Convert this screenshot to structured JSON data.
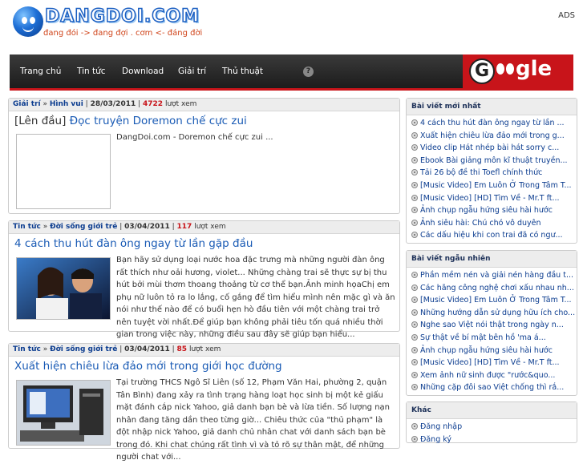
{
  "header": {
    "logo_text": "DANGDOI.COM",
    "tagline": "đang đói -> đang đợi . cơm <- đáng đời",
    "ads": "ADS"
  },
  "nav": {
    "items": [
      "Trang chủ",
      "Tin tức",
      "Download",
      "Giải trí",
      "Thủ thuật"
    ],
    "help": "?",
    "google_badge": "G",
    "google_word": "gle"
  },
  "posts": [
    {
      "cat1": "Giải trí",
      "sep": "»",
      "cat2": "Hình vui",
      "date": "28/03/2011",
      "views": "4722",
      "views_label": "lượt xem",
      "title_prefix": "[Lên đầu]",
      "title": "Đọc truyện Doremon chế cực zui",
      "excerpt": "DangDoi.com - Doremon chế cực zui ..."
    },
    {
      "cat1": "Tin tức",
      "sep": "»",
      "cat2": "Đời sống giới trẻ",
      "date": "03/04/2011",
      "views": "117",
      "views_label": "lượt xem",
      "title": "4 cách thu hút đàn ông ngay từ lần gặp đầu",
      "excerpt": "Bạn hãy sử dụng loại nước hoa đặc trưng mà những người đàn ông rất thích như oải hương, violet... Những chàng trai sẽ thực sự bị thu hút bởi mùi thơm thoang thoảng từ cơ thể bạn.Ảnh minh họaChị em phụ nữ luôn tỏ ra lo lắng, cố gắng để tìm hiểu mình nên mặc gì và ăn nói như thế nào để có buổi hẹn hò đầu tiên với một chàng trai trở nên tuyệt vời nhất.Để giúp bạn không phải tiêu tốn quá nhiều thời gian trong việc này, những điều sau đây sẽ giúp bạn hiểu..."
    },
    {
      "cat1": "Tin tức",
      "sep": "»",
      "cat2": "Đời sống giới trẻ",
      "date": "03/04/2011",
      "views": "85",
      "views_label": "lượt xem",
      "title": "Xuất hiện chiêu lừa đảo mới trong giới học đường",
      "excerpt": "Tại trường THCS Ngô Sĩ Liên (số 12, Phạm Văn Hai, phường 2, quận Tân Bình) đang xảy ra tình trạng hàng loạt học sinh bị một kẻ giấu mặt đánh cắp nick Yahoo, giả danh bạn bè và lừa tiền. Số lượng nạn nhân đang tăng dần theo từng giờ... Chiêu thức của \"thủ phạm\" là đột nhập nick Yahoo, giả danh chủ nhân chat với danh sách bạn bè trong đó. Khi chat chúng rất tình vì và tỏ rõ sự thân mật, để những người chat với..."
    }
  ],
  "sidebar": {
    "newest": {
      "title": "Bài viết mới nhất",
      "items": [
        "4 cách thu hút đàn ông ngay từ lần ...",
        "Xuất hiện chiêu lừa đảo mới trong g...",
        "Video clip Hát nhép bài hát sorry c...",
        "Ebook Bài giảng môn kĩ thuật truyền...",
        "Tải 26 bộ đề thi Toefl chính thức",
        "[Music Video] Em Luôn Ở Trong Tâm T...",
        "[Music Video] [HD] Tìm Về - Mr.T ft...",
        "Ảnh chụp ngẫu hứng siêu hài hước",
        "Ảnh siêu hài: Chú chó vô duyên",
        "Các dấu hiệu khi con trai đã có ngư..."
      ]
    },
    "random": {
      "title": "Bài viết ngẫu nhiên",
      "items": [
        "Phần mềm nén và giải nén hàng đầu t...",
        "Các hãng công nghệ chơi xấu nhau nh...",
        "[Music Video] Em Luôn Ở Trong Tâm T...",
        "Những hướng dẫn sử dụng hữu ích cho...",
        "Nghe sao Việt nói thật trong ngày n...",
        "Sự thật về bí mật bên hồ 'ma á...",
        "Ảnh chụp ngẫu hứng siêu hài hước",
        "[Music Video] [HD] Tìm Về - Mr.T ft...",
        "Xem ảnh nữ sinh được \"rước&quo...",
        "Những cặp đôi sao Việt chống thì rắ..."
      ]
    },
    "other": {
      "title": "Khác",
      "items": [
        "Đăng nhập",
        "Đăng ký"
      ]
    }
  },
  "colors": {
    "accent_red": "#c8141a",
    "link_blue": "#1a5bb5",
    "nav_dark": "#1c1c1c"
  }
}
